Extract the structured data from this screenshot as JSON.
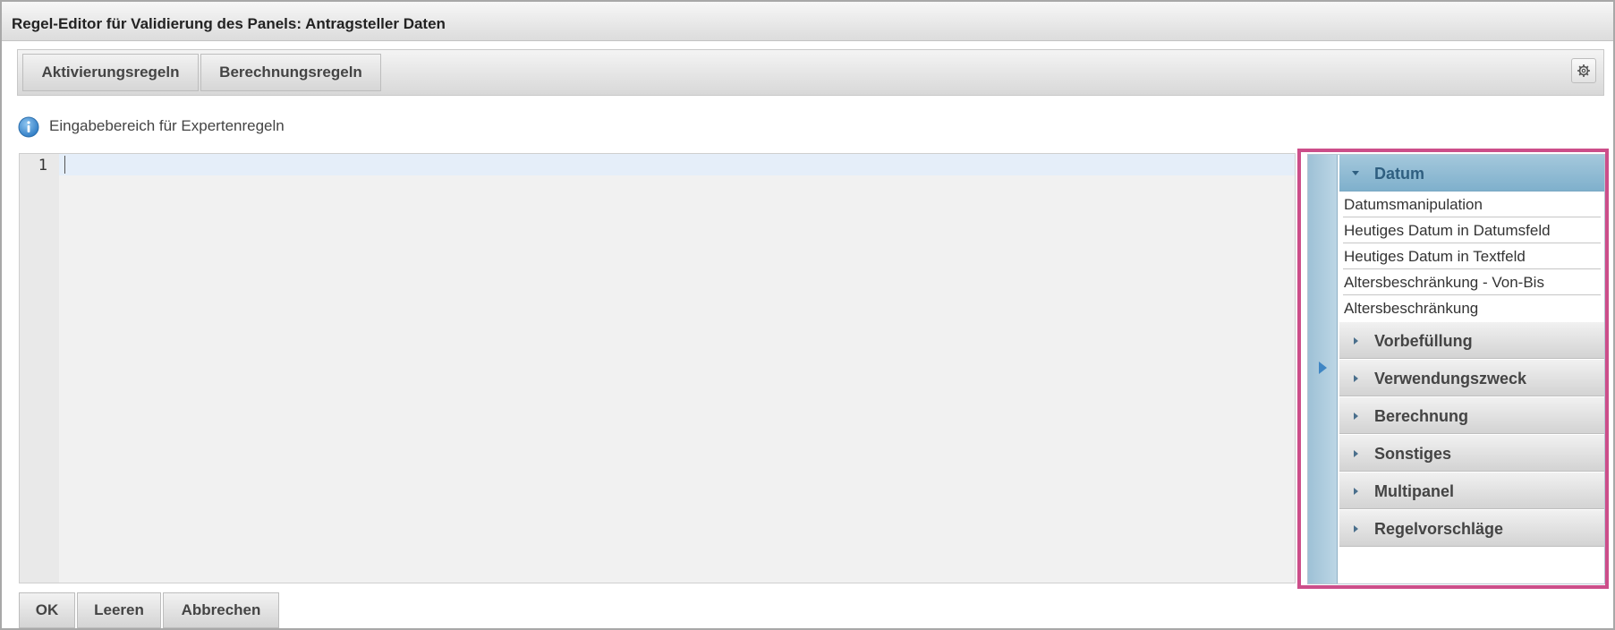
{
  "dialog": {
    "title": "Regel-Editor für Validierung des Panels: Antragsteller Daten"
  },
  "toolbar": {
    "tabs": [
      {
        "label": "Aktivierungsregeln"
      },
      {
        "label": "Berechnungsregeln"
      }
    ],
    "settings_icon": "gear-icon"
  },
  "info": {
    "icon": "info-icon",
    "text": "Eingabebereich für Expertenregeln"
  },
  "editor": {
    "line_numbers": [
      "1"
    ],
    "content": ""
  },
  "side_panel": {
    "collapse_icon": "triangle-right-icon",
    "sections": [
      {
        "label": "Datum",
        "expanded": true,
        "items": [
          "Datumsmanipulation",
          "Heutiges Datum in Datumsfeld",
          "Heutiges Datum in Textfeld",
          "Altersbeschränkung - Von-Bis",
          "Altersbeschränkung"
        ]
      },
      {
        "label": "Vorbefüllung",
        "expanded": false
      },
      {
        "label": "Verwendungszweck",
        "expanded": false
      },
      {
        "label": "Berechnung",
        "expanded": false
      },
      {
        "label": "Sonstiges",
        "expanded": false
      },
      {
        "label": "Multipanel",
        "expanded": false
      },
      {
        "label": "Regelvorschläge",
        "expanded": false
      }
    ],
    "highlight_color": "#cc4e8a"
  },
  "footer": {
    "ok_label": "OK",
    "clear_label": "Leeren",
    "cancel_label": "Abbrechen"
  }
}
